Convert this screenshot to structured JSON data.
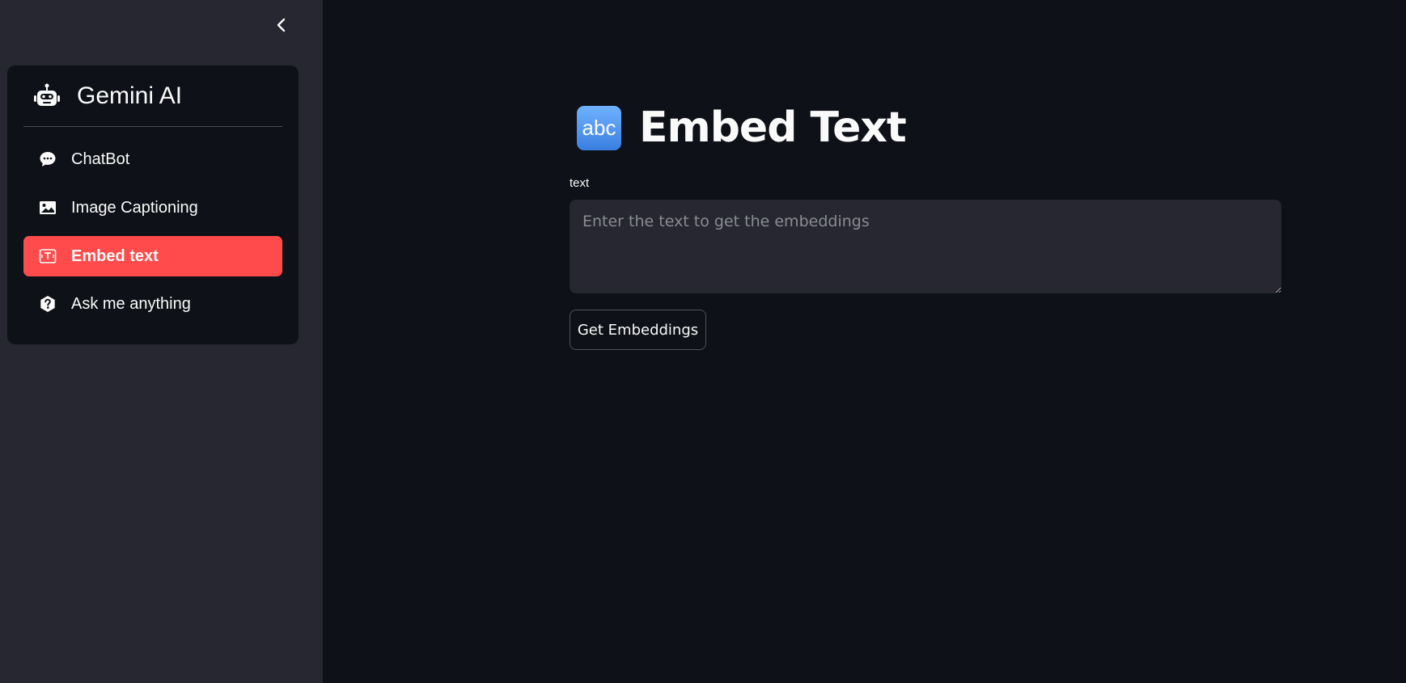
{
  "sidebar": {
    "collapse_icon": "chevron-left-icon",
    "app_title": "Gemini AI",
    "app_icon": "robot-icon",
    "items": [
      {
        "label": "ChatBot",
        "icon": "chat-bubble-icon",
        "active": false
      },
      {
        "label": "Image Captioning",
        "icon": "image-icon",
        "active": false
      },
      {
        "label": "Embed text",
        "icon": "text-embed-icon",
        "active": true
      },
      {
        "label": "Ask me anything",
        "icon": "question-circle-icon",
        "active": false
      }
    ]
  },
  "main": {
    "emoji": "abc",
    "title": "Embed Text",
    "input_label": "text",
    "input_placeholder": "Enter the text to get the embeddings",
    "input_value": "",
    "button_label": "Get Embeddings"
  },
  "colors": {
    "accent": "#ff4b4b",
    "background": "#0e1117",
    "sidebar": "#262730"
  }
}
